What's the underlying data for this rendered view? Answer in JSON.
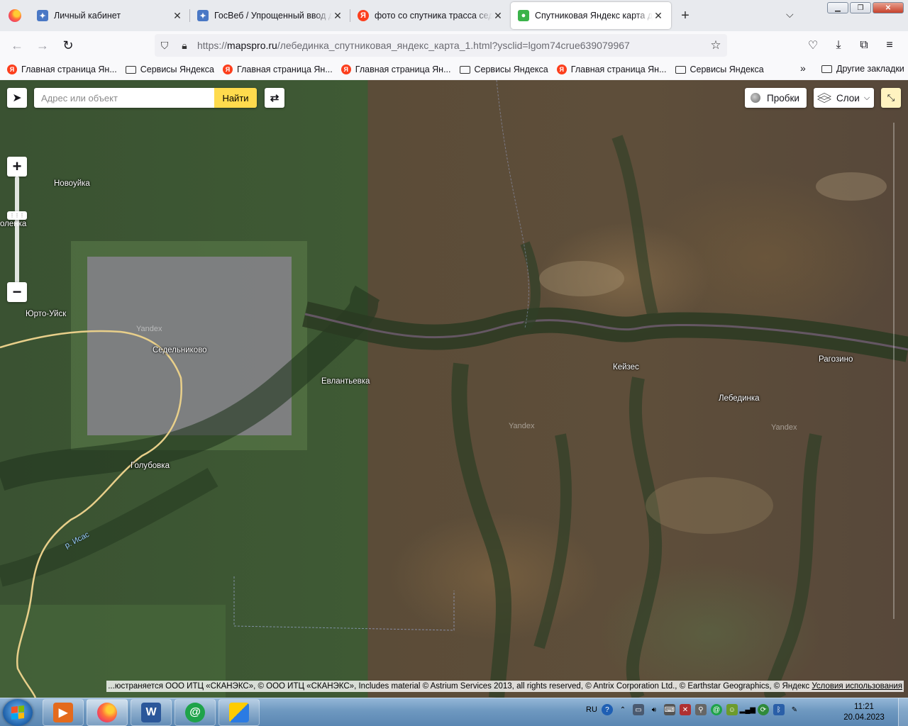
{
  "browser": {
    "tabs": [
      {
        "title": "Личный кабинет",
        "icon": "gosuslugi-icon",
        "active": false
      },
      {
        "title": "ГосВеб / Упрощенный ввод да",
        "icon": "gosuslugi-icon",
        "active": false
      },
      {
        "title": "фото со спутника трасса седе",
        "icon": "yandex-icon",
        "active": false
      },
      {
        "title": "Спутниковая Яндекс карта дер",
        "icon": "map-pin-icon",
        "active": true
      }
    ],
    "url_prefix": "https://",
    "url_domain": "mapspro.ru",
    "url_path": "/лебединка_спутниковая_яндекс_карта_1.html?ysclid=lgom74crue639079967",
    "bookmarks": [
      {
        "label": "Главная страница Ян...",
        "type": "yandex"
      },
      {
        "label": "Сервисы Яндекса",
        "type": "folder"
      },
      {
        "label": "Главная страница Ян...",
        "type": "yandex"
      },
      {
        "label": "Главная страница Ян...",
        "type": "yandex"
      },
      {
        "label": "Сервисы Яндекса",
        "type": "folder"
      },
      {
        "label": "Главная страница Ян...",
        "type": "yandex"
      },
      {
        "label": "Сервисы Яндекса",
        "type": "folder"
      }
    ],
    "other_bookmarks": "Другие закладки"
  },
  "map": {
    "search_placeholder": "Адрес или объект",
    "search_button": "Найти",
    "traffic_label": "Пробки",
    "layers_label": "Слои",
    "places": [
      {
        "name": "Новоуйка"
      },
      {
        "name": "оленка"
      },
      {
        "name": "Юрто-Уйск"
      },
      {
        "name": "Седельниково"
      },
      {
        "name": "Евлантьевка"
      },
      {
        "name": "Голубовка"
      },
      {
        "name": "Кейзес"
      },
      {
        "name": "Лебединка"
      },
      {
        "name": "Рагозино"
      }
    ],
    "river_label": "р. Исас",
    "watermark": "Yandex",
    "copyright": "...юстраняется ООО ИТЦ «СКАНЭКС», © ООО ИТЦ «СКАНЭКС», Includes material © Astrium Services 2013, all rights reserved, © Antrix Corporation Ltd., © Earthstar Geographics, © Яндекс",
    "terms_link": "Условия использования"
  },
  "taskbar": {
    "apps": [
      {
        "name": "media-player"
      },
      {
        "name": "firefox"
      },
      {
        "name": "word"
      },
      {
        "name": "mail-agent"
      },
      {
        "name": "yandex-browser"
      }
    ],
    "lang": "RU",
    "time": "11:21",
    "date": "20.04.2023"
  }
}
